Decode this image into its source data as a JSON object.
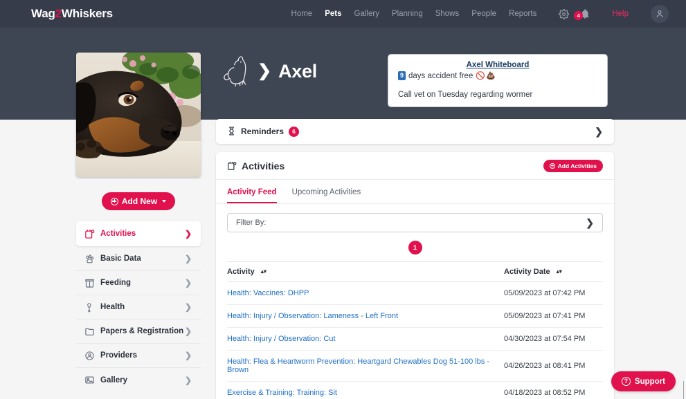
{
  "topnav": {
    "logo_prefix": "Wag",
    "logo_accent": "2",
    "logo_suffix": "Whiskers",
    "items": [
      {
        "label": "Home",
        "active": false
      },
      {
        "label": "Pets",
        "active": true
      },
      {
        "label": "Gallery",
        "active": false
      },
      {
        "label": "Planning",
        "active": false
      },
      {
        "label": "Shows",
        "active": false
      },
      {
        "label": "People",
        "active": false
      },
      {
        "label": "Reports",
        "active": false
      }
    ],
    "settings_icon": "gear-icon",
    "notifications_icon": "bell-icon",
    "notifications_count": "4",
    "help_label": "Help",
    "avatar_icon": "user-icon"
  },
  "hero": {
    "breadcrumb_icon": "dog-cat-icon",
    "breadcrumb_separator": "❯",
    "pet_name": "Axel",
    "pet_photo_alt": "rottweiler-photo"
  },
  "whiteboard": {
    "title": "Axel Whiteboard",
    "days_count": "9",
    "days_text": "days accident free",
    "emoji": "🚫💩",
    "note": "Call vet on Tuesday regarding wormer"
  },
  "sidebar": {
    "add_new_label": "Add New",
    "items": [
      {
        "label": "Activities",
        "icon": "activities-icon",
        "active": true
      },
      {
        "label": "Basic Data",
        "icon": "paw-data-icon",
        "active": false
      },
      {
        "label": "Feeding",
        "icon": "feeding-icon",
        "active": false
      },
      {
        "label": "Health",
        "icon": "health-icon",
        "active": false
      },
      {
        "label": "Papers & Registration",
        "icon": "papers-icon",
        "active": false
      },
      {
        "label": "Providers",
        "icon": "providers-icon",
        "active": false
      },
      {
        "label": "Gallery",
        "icon": "gallery-icon",
        "active": false
      }
    ]
  },
  "reminders": {
    "icon": "hourglass-icon",
    "label": "Reminders",
    "count": "6"
  },
  "activities": {
    "icon": "activities-icon",
    "title": "Activities",
    "add_button_label": "Add Activities",
    "tabs": [
      {
        "label": "Activity Feed",
        "active": true
      },
      {
        "label": "Upcoming Activities",
        "active": false
      }
    ],
    "filter_label": "Filter By:",
    "page_number": "1",
    "columns": [
      {
        "label": "Activity",
        "sortable": true
      },
      {
        "label": "Activity Date",
        "sortable": true
      }
    ],
    "rows": [
      {
        "activity": "Health: Vaccines: DHPP",
        "date": "05/09/2023 at 07:42 PM"
      },
      {
        "activity": "Health: Injury / Observation: Lameness - Left Front",
        "date": "05/09/2023 at 07:41 PM"
      },
      {
        "activity": "Health: Injury / Observation: Cut",
        "date": "04/30/2023 at 07:54 PM"
      },
      {
        "activity": "Health: Flea & Heartworm Prevention: Heartgard Chewables Dog 51-100 lbs - Brown",
        "date": "04/26/2023 at 08:41 PM"
      },
      {
        "activity": "Exercise & Training: Training: Sit",
        "date": "04/18/2023 at 08:52 PM"
      }
    ]
  },
  "support": {
    "label": "Support",
    "icon": "question-circle-icon"
  },
  "colors": {
    "brand": "#e0114d",
    "nav_bg": "#363c4a",
    "hero_bg": "#3e4553",
    "page_bg": "#f5f5f6",
    "link": "#1f6fc4"
  }
}
